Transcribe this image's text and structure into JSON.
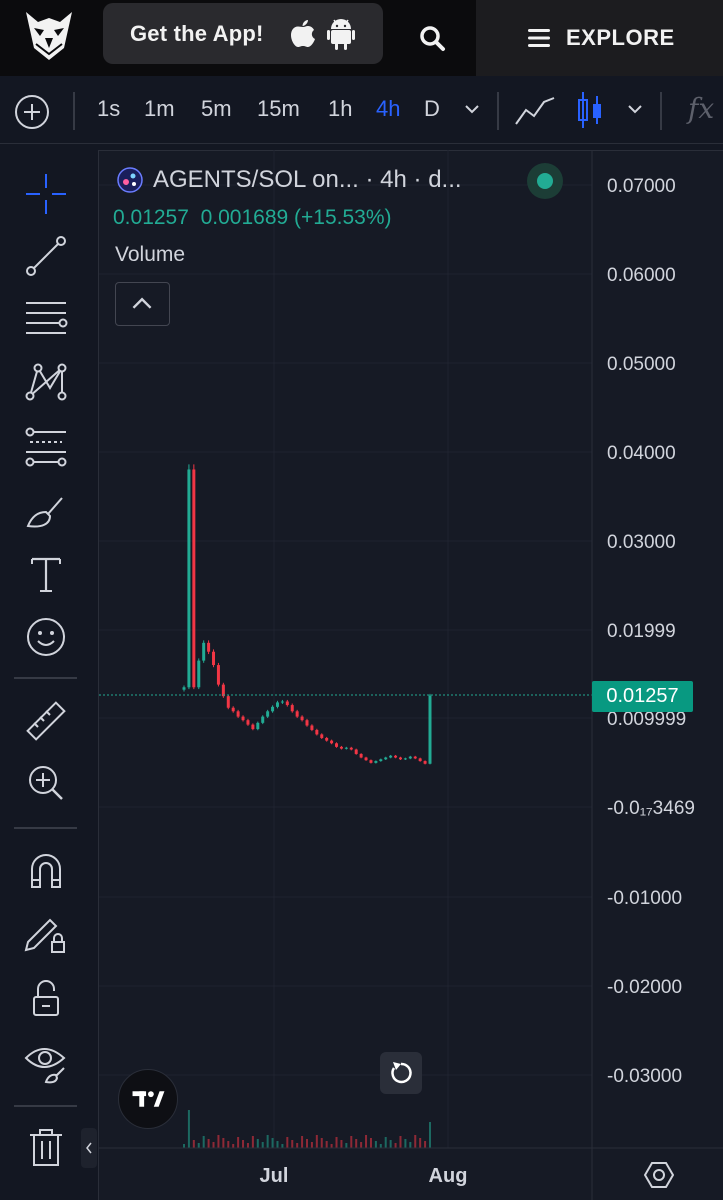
{
  "header": {
    "logo_icon": "owl-logo-icon",
    "get_app_label": "Get the App!",
    "explore_label": "EXPLORE"
  },
  "toolbar": {
    "intervals": [
      "1s",
      "1m",
      "5m",
      "15m",
      "1h",
      "4h",
      "D"
    ],
    "active_interval": "4h",
    "fx_label": "fx"
  },
  "legend": {
    "symbol": "AGENTS/SOL on... · 4h · d...",
    "last_price": "0.01257",
    "change": "0.001689",
    "change_pct": "(+15.53%)",
    "volume_label": "Volume"
  },
  "price_axis": {
    "labels": [
      "0.07000",
      "0.06000",
      "0.05000",
      "0.04000",
      "0.03000",
      "0.01999",
      "0.009999",
      "-0.0₁₇3469",
      "-0.01000",
      "-0.02000",
      "-0.03000"
    ],
    "current_price_tag": "0.01257"
  },
  "time_axis": {
    "labels": [
      "Jul",
      "Aug"
    ]
  },
  "colors": {
    "background": "#161a25",
    "up": "#22ab94",
    "down": "#f23645",
    "accent": "#2962ff",
    "price_tag": "#089981"
  },
  "chart_data": {
    "type": "candlestick",
    "title": "AGENTS/SOL on... · 4h · d...",
    "interval": "4h",
    "ylim": [
      -0.035,
      0.072
    ],
    "x_ticks": [
      "Jul",
      "Aug"
    ],
    "last": 0.01257,
    "approx_close_series": [
      0.0135,
      0.038,
      0.0135,
      0.0165,
      0.0185,
      0.0175,
      0.016,
      0.0138,
      0.0125,
      0.0112,
      0.0108,
      0.0102,
      0.0098,
      0.0093,
      0.0088,
      0.0095,
      0.0102,
      0.0108,
      0.0113,
      0.0118,
      0.0119,
      0.0115,
      0.0108,
      0.0102,
      0.0098,
      0.0092,
      0.0087,
      0.0082,
      0.0078,
      0.0075,
      0.0072,
      0.0068,
      0.0066,
      0.0067,
      0.0065,
      0.006,
      0.0056,
      0.0053,
      0.005,
      0.0052,
      0.0054,
      0.0056,
      0.0058,
      0.0056,
      0.0054,
      0.0055,
      0.0057,
      0.0055,
      0.0052,
      0.0049,
      0.01257
    ],
    "annotations": [
      "price line at 0.01257"
    ]
  }
}
